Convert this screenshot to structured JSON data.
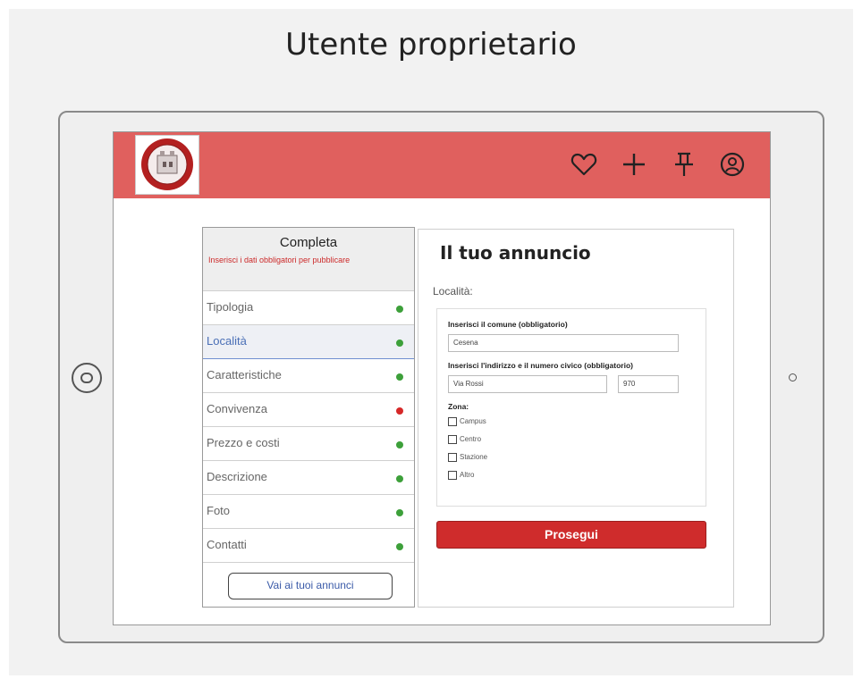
{
  "page_title": "Utente proprietario",
  "topbar": {
    "accent_color": "#e0605e",
    "icons": [
      "heart-icon",
      "plus-icon",
      "pin-icon",
      "user-icon"
    ]
  },
  "sidebar": {
    "heading": "Completa",
    "warning": "Inserisci i dati obbligatori per pubblicare",
    "steps": [
      {
        "label": "Tipologia",
        "status": "ok"
      },
      {
        "label": "Località",
        "status": "ok"
      },
      {
        "label": "Caratteristiche",
        "status": "ok"
      },
      {
        "label": "Convivenza",
        "status": "error"
      },
      {
        "label": "Prezzo e costi",
        "status": "ok"
      },
      {
        "label": "Descrizione",
        "status": "ok"
      },
      {
        "label": "Foto",
        "status": "ok"
      },
      {
        "label": "Contatti",
        "status": "ok"
      }
    ],
    "my_ads_button": "Vai ai tuoi annunci"
  },
  "panel": {
    "title": "Il tuo annuncio",
    "section": "Località:",
    "comune_label": "Inserisci il comune (obbligatorio)",
    "comune_value": "Cesena",
    "address_label": "Inserisci l'indirizzo e il numero civico (obbligatorio)",
    "address_value": "Via Rossi",
    "number_value": "970",
    "zone_label": "Zona:",
    "zones": [
      "Campus",
      "Centro",
      "Stazione",
      "Altro"
    ],
    "continue_button": "Prosegui"
  }
}
